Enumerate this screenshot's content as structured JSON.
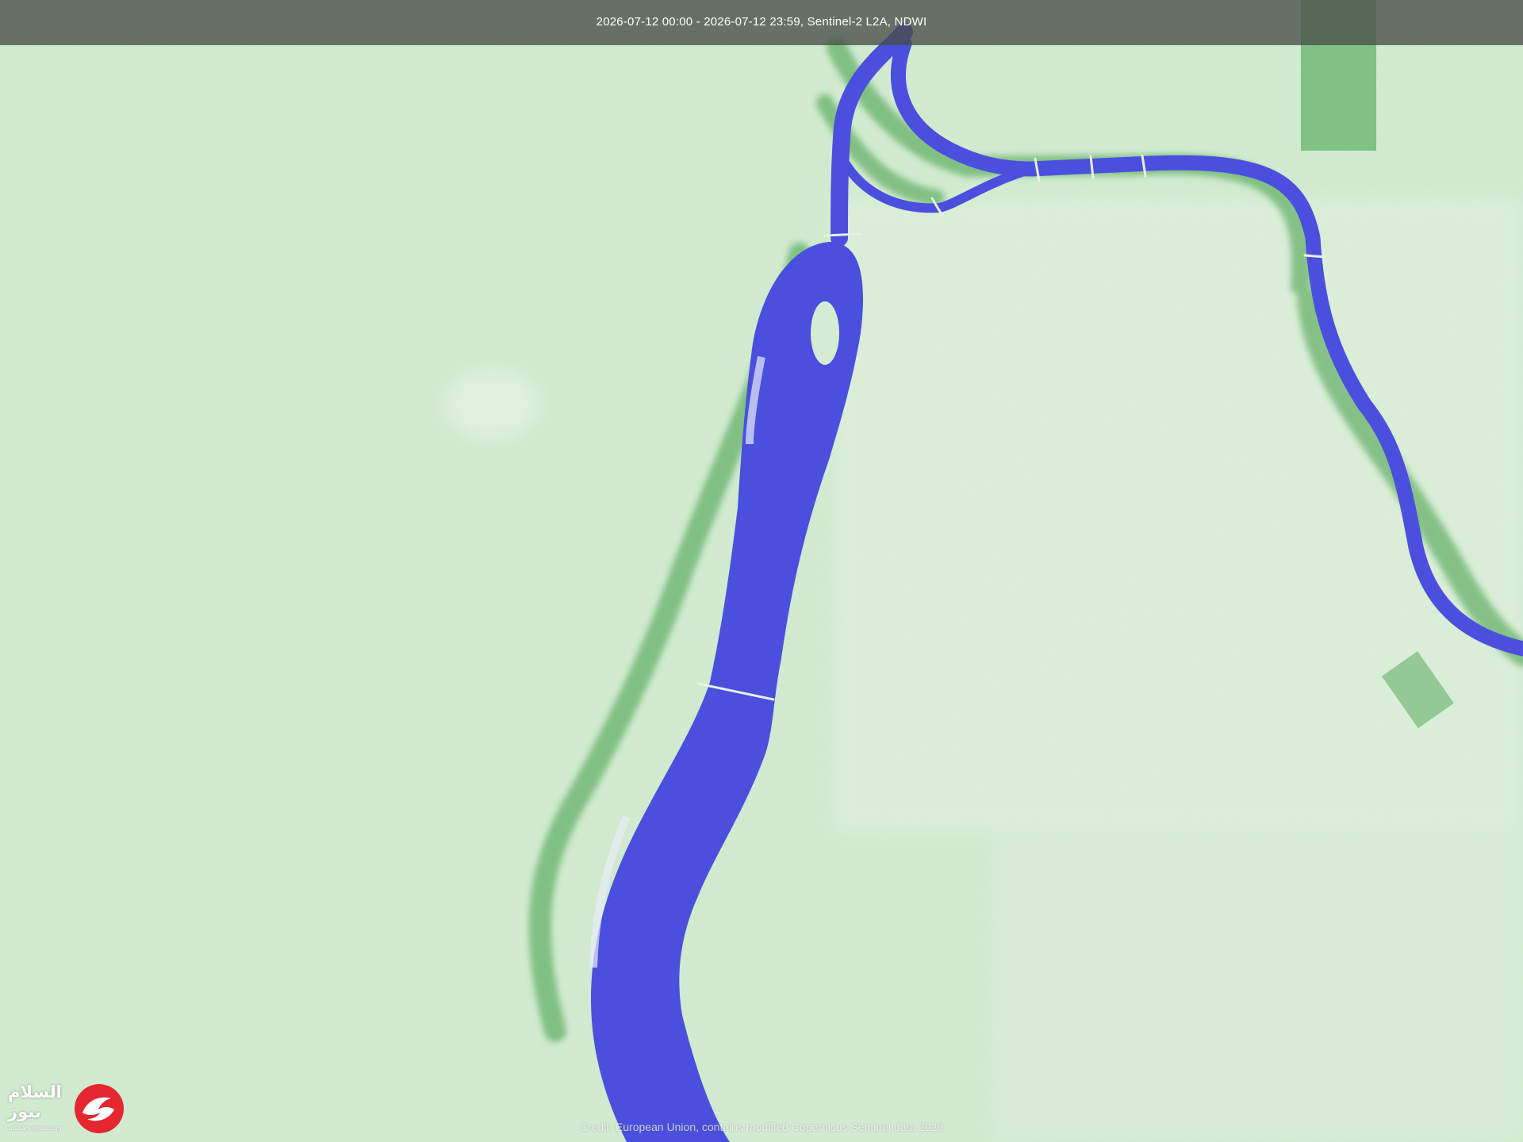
{
  "map": {
    "header": "2026-07-12 00:00 - 2026-07-12 23:59, Sentinel-2 L2A, NDWI",
    "credit": "Credit: European Union, contains modified Copernicus Sentinel data 2026",
    "colors": {
      "land": "#cde8cc",
      "vegetation": "#3f9e45",
      "water": "#4a50dd",
      "header_bg": "#4a4e48"
    }
  },
  "logo": {
    "name_line1": "السلام",
    "name_line2": "نيوز",
    "url": "alsalam-news.com",
    "colors": {
      "brand": "#e3262f",
      "text": "#ffffff"
    }
  }
}
